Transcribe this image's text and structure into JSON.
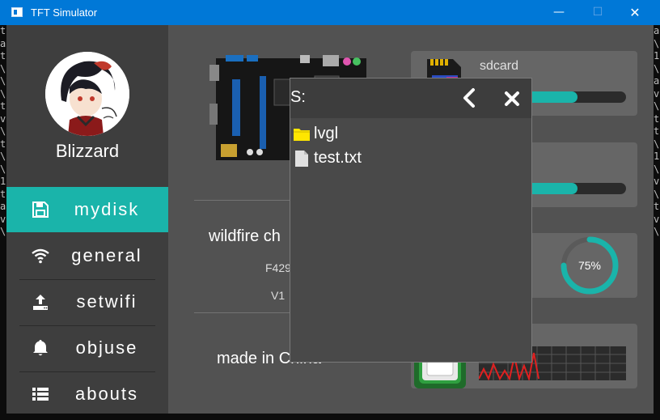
{
  "window": {
    "title": "TFT Simulator",
    "minimize": "—",
    "maximize": "☐",
    "close": "✕"
  },
  "console": {
    "left_chars": "tat\\a\\v\\ttv\\vt\\t\\t1tav\\t",
    "right_chars": "a\\v1\\tav\\vtt\\a1\\tv\\atv\\t"
  },
  "user": {
    "name": "Blizzard"
  },
  "menu": {
    "items": [
      {
        "label": "mydisk",
        "icon": "save-icon",
        "active": true
      },
      {
        "label": "general",
        "icon": "wifi-icon",
        "active": false
      },
      {
        "label": "setwifi",
        "icon": "upload-icon",
        "active": false
      },
      {
        "label": "objuse",
        "icon": "bell-icon",
        "active": false
      },
      {
        "label": "abouts",
        "icon": "list-icon",
        "active": false
      }
    ]
  },
  "info": {
    "title": "wildfire ch",
    "model": "F429",
    "version": "V1",
    "made": "made in China"
  },
  "cards": {
    "sdcard": {
      "title": "sdcard",
      "fill_fraction": 0.67
    },
    "flash": {
      "fill_fraction": 0.67
    },
    "gauge": {
      "label": "75%",
      "value": 75
    },
    "chart": {
      "color": "#e02020"
    }
  },
  "dialog": {
    "path": "S:",
    "back_icon": "chevron-left-icon",
    "close_icon": "close-icon",
    "files": [
      {
        "name": "lvgl",
        "type": "folder",
        "icon": "folder-icon"
      },
      {
        "name": "test.txt",
        "type": "file",
        "icon": "file-icon"
      }
    ]
  },
  "colors": {
    "accent": "#1ab4aa",
    "titlebar": "#0078d7",
    "folder": "#ffe600",
    "chart_line": "#e02020"
  }
}
